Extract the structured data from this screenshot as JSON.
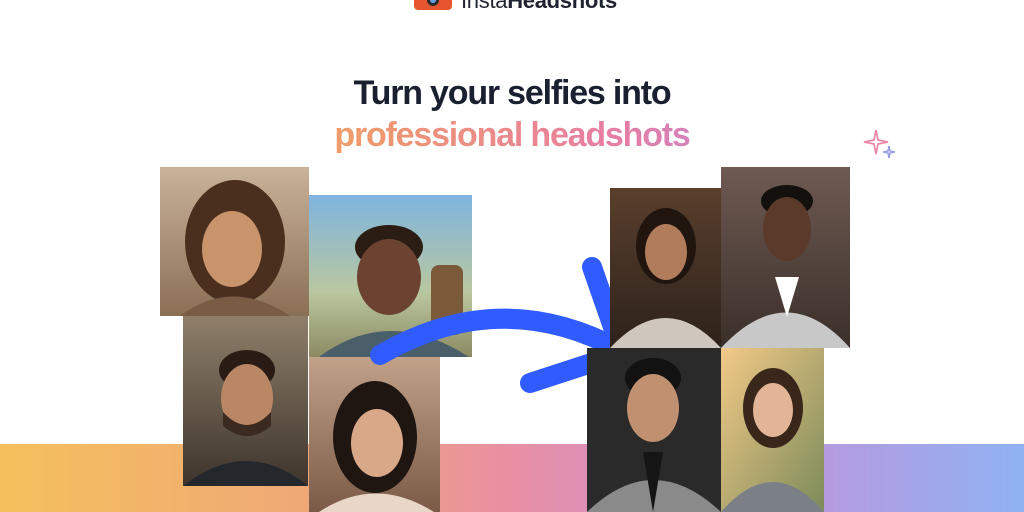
{
  "header": {
    "logo_light": "Insta",
    "logo_bold": "Headshots"
  },
  "hero": {
    "line1": "Turn your selfies into",
    "line2": "professional headshots"
  },
  "colors": {
    "accent_arrow": "#2f5bff",
    "gradient": [
      "#f5b94e",
      "#e77da4",
      "#7fb3f3"
    ]
  },
  "selfies": [
    {
      "name": "selfie-woman-long-hair"
    },
    {
      "name": "selfie-man-backpack"
    },
    {
      "name": "selfie-man-beard"
    },
    {
      "name": "selfie-woman-laughing"
    }
  ],
  "headshots": [
    {
      "name": "headshot-woman-blazer"
    },
    {
      "name": "headshot-man-grey-suit"
    },
    {
      "name": "headshot-man-black-suit"
    },
    {
      "name": "headshot-woman-outdoor"
    }
  ]
}
